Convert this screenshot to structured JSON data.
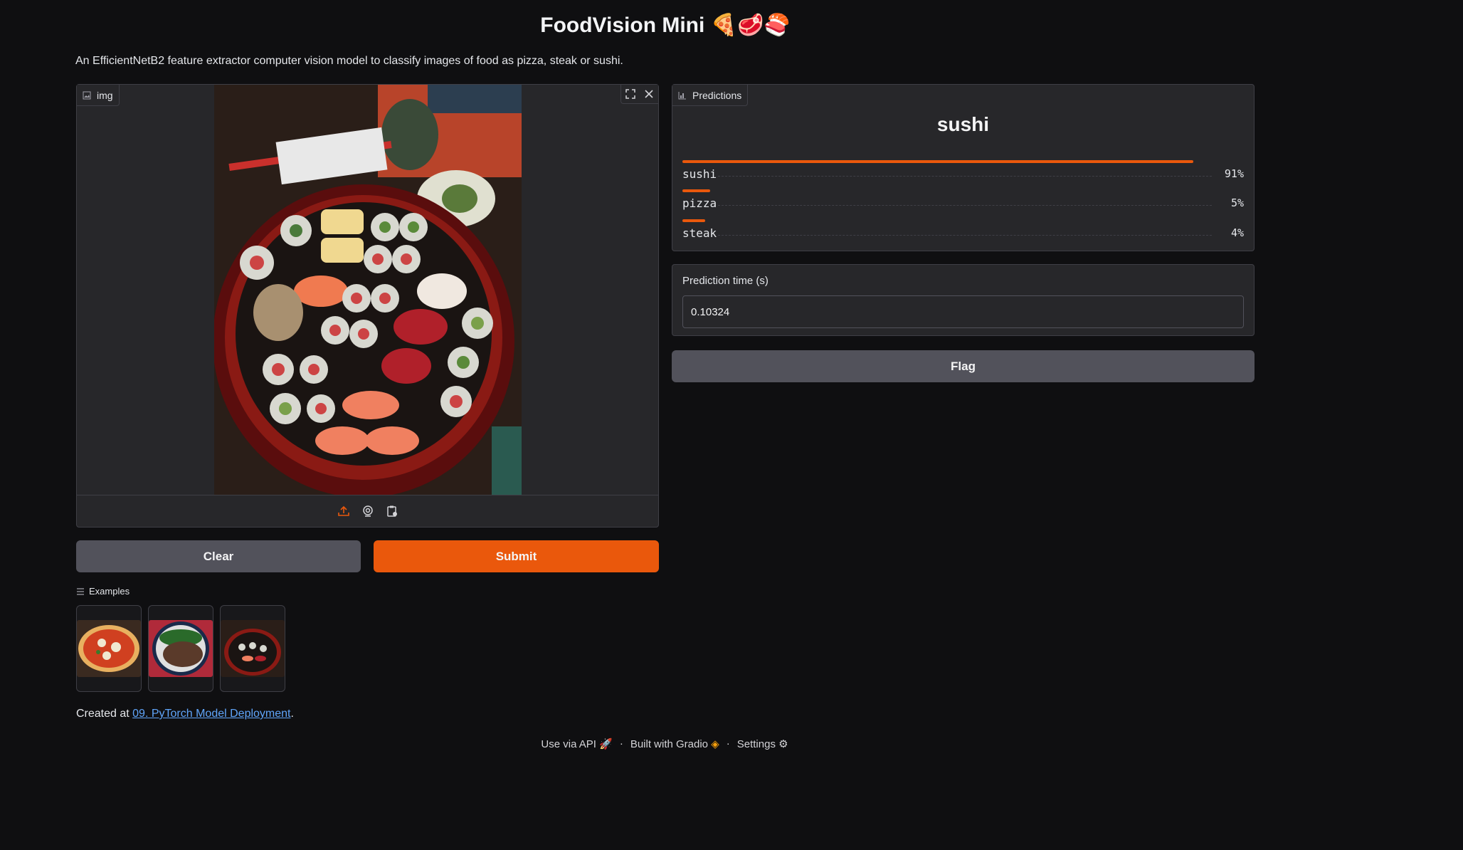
{
  "header": {
    "title": "FoodVision Mini 🍕🥩🍣",
    "description": "An EfficientNetB2 feature extractor computer vision model to classify images of food as pizza, steak or sushi."
  },
  "image_input": {
    "label": "img"
  },
  "buttons": {
    "clear": "Clear",
    "submit": "Submit",
    "flag": "Flag"
  },
  "predictions": {
    "label": "Predictions",
    "top_label": "sushi",
    "items": [
      {
        "name": "sushi",
        "percent": "91%",
        "value": 0.91
      },
      {
        "name": "pizza",
        "percent": "5%",
        "value": 0.05
      },
      {
        "name": "steak",
        "percent": "4%",
        "value": 0.04
      }
    ]
  },
  "prediction_time": {
    "label": "Prediction time (s)",
    "value": "0.10324"
  },
  "examples": {
    "label": "Examples"
  },
  "created": {
    "prefix": "Created at ",
    "link_text": "09. PyTorch Model Deployment",
    "suffix": "."
  },
  "footer": {
    "api": "Use via API",
    "built": "Built with Gradio",
    "settings": "Settings",
    "separator": "·"
  },
  "colors": {
    "accent": "#ea580c",
    "background": "#0f0f11",
    "panel": "#27272a"
  }
}
